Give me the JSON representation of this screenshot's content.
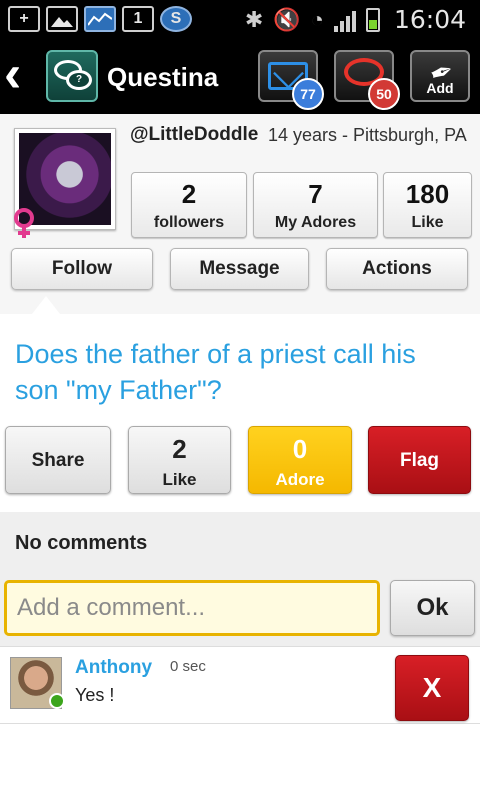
{
  "status_bar": {
    "time": "16:04",
    "left_icons": [
      "plus-icon",
      "image-icon",
      "chart-icon",
      "calendar-icon",
      "skype-icon"
    ],
    "calendar_day": "1",
    "skype_letter": "S",
    "right_icons": [
      "bluetooth-icon",
      "mute-icon",
      "wifi-icon",
      "signal-icon",
      "battery-icon"
    ]
  },
  "app_bar": {
    "title": "Questina",
    "mail_count": "77",
    "chat_count": "50",
    "add_label": "Add",
    "logo_text": "?"
  },
  "profile": {
    "username": "@LittleDoddle",
    "info": "14 years - Pittsburgh, PA",
    "stats": [
      {
        "value": "2",
        "label": "followers"
      },
      {
        "value": "7",
        "label": "My Adores"
      },
      {
        "value": "180",
        "label": "Like"
      }
    ],
    "buttons": {
      "follow": "Follow",
      "message": "Message",
      "actions": "Actions"
    }
  },
  "question": {
    "text": "Does the father of a priest call his son \"my Father\"?",
    "share_label": "Share",
    "like_count": "2",
    "like_label": "Like",
    "adore_count": "0",
    "adore_label": "Adore",
    "flag_label": "Flag"
  },
  "comments": {
    "heading": "No comments",
    "input_placeholder": "Add a comment...",
    "ok_label": "Ok",
    "items": [
      {
        "author": "Anthony",
        "time": "0 sec",
        "text": "Yes !",
        "delete_label": "X"
      }
    ]
  },
  "colors": {
    "accent_blue": "#2aa0e0",
    "flag_red": "#c4161c",
    "adore_yellow": "#f7c20f",
    "input_border": "#e8b300"
  }
}
